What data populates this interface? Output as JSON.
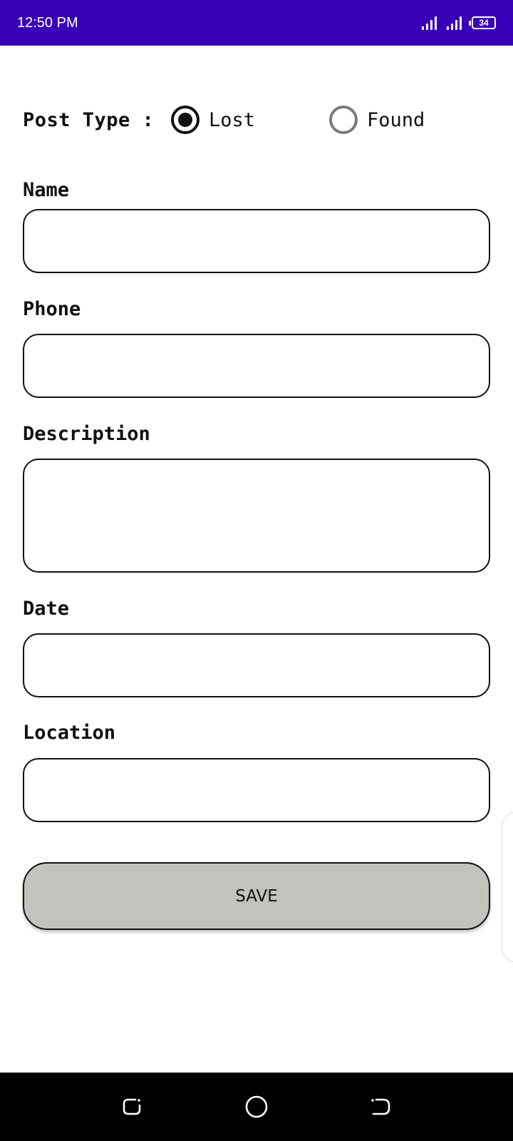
{
  "status_bar": {
    "time": "12:50 PM",
    "battery_level": "34"
  },
  "post_type": {
    "label": "Post Type :",
    "options": [
      {
        "label": "Lost",
        "selected": true
      },
      {
        "label": "Found",
        "selected": false
      }
    ]
  },
  "fields": {
    "name": {
      "label": "Name",
      "value": ""
    },
    "phone": {
      "label": "Phone",
      "value": ""
    },
    "description": {
      "label": "Description",
      "value": ""
    },
    "date": {
      "label": "Date",
      "value": ""
    },
    "location": {
      "label": "Location",
      "value": ""
    }
  },
  "save_button": {
    "label": "SAVE"
  },
  "colors": {
    "status_bar": "#3a00b7",
    "save_button": "#c4c2bc",
    "nav_bar": "#000000"
  },
  "nav_icons": [
    "recent-apps-icon",
    "home-icon",
    "back-icon"
  ]
}
